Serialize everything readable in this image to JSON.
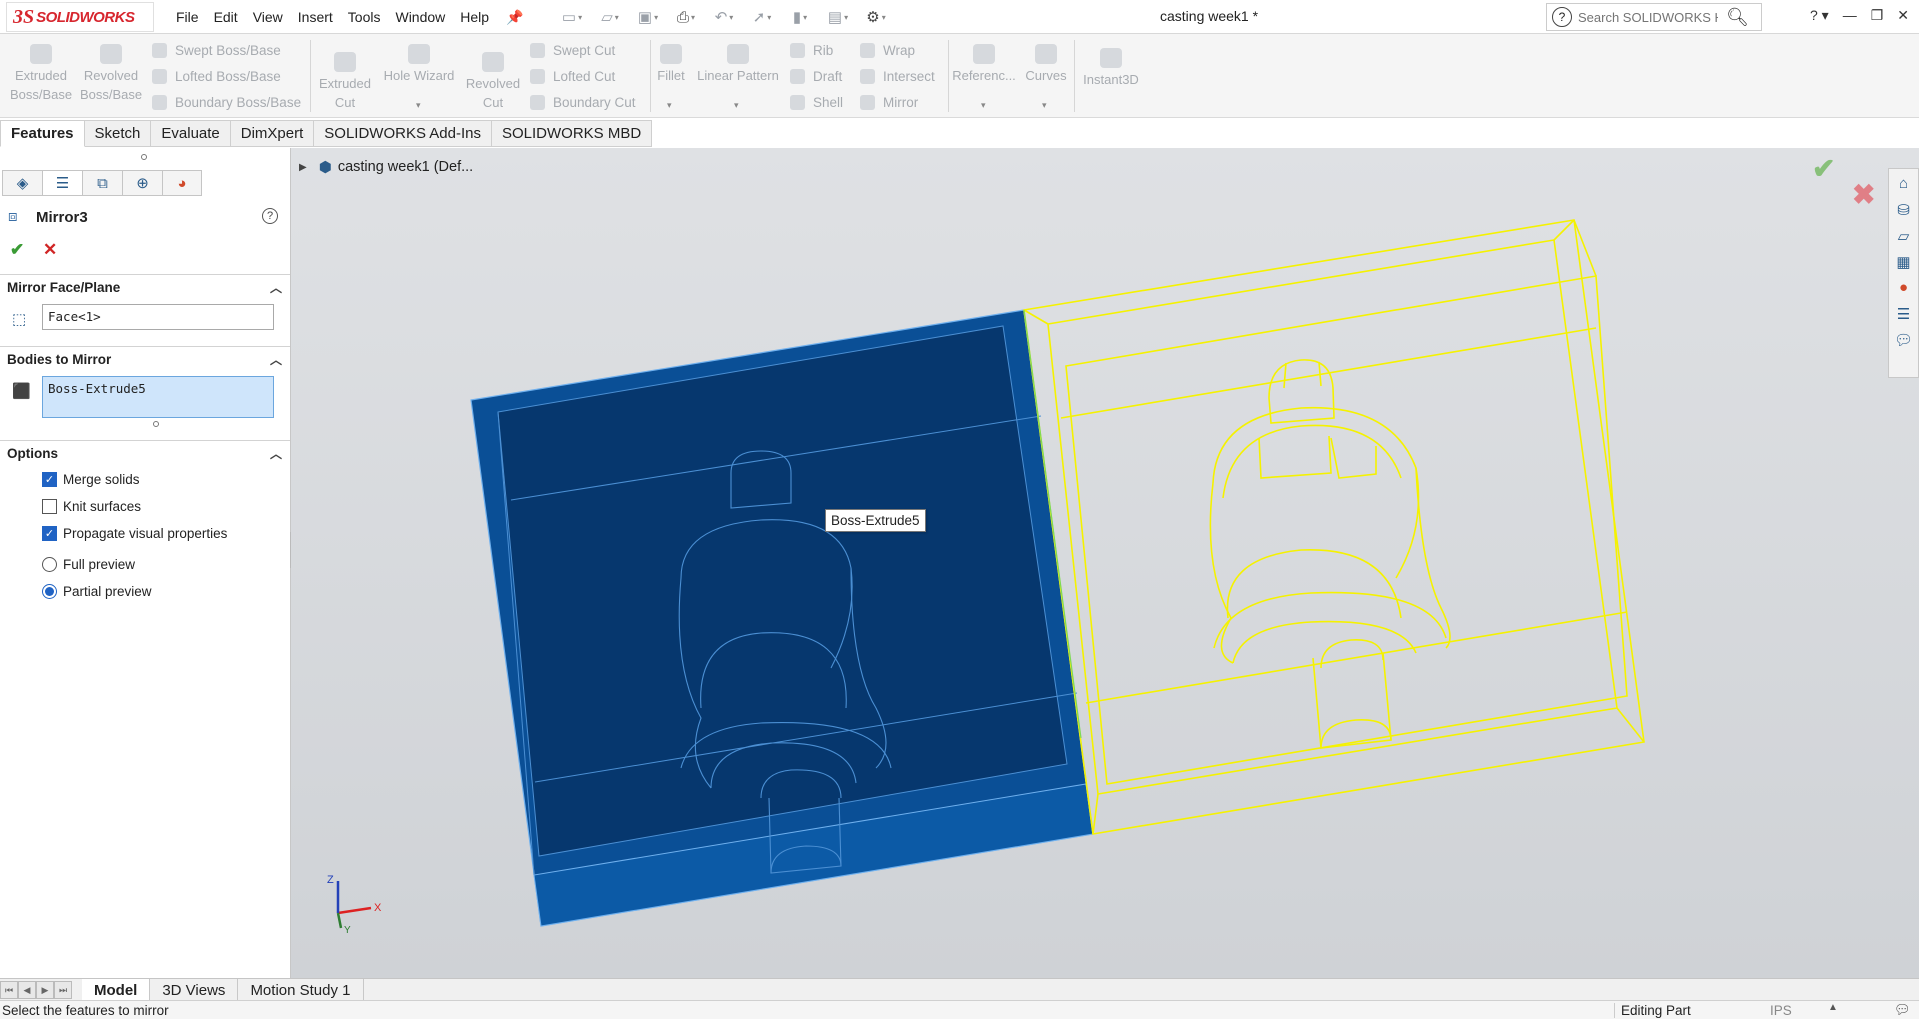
{
  "app": {
    "logo_mark": "3S",
    "logo_text": "SOLIDWORKS",
    "doc_title": "casting week1 *",
    "menu": [
      "File",
      "Edit",
      "View",
      "Insert",
      "Tools",
      "Window",
      "Help"
    ],
    "help_search_placeholder": "Search SOLIDWORKS Help",
    "accent_color": "#d7262e"
  },
  "ribbon": {
    "extruded_boss": [
      "Extruded",
      "Boss/Base"
    ],
    "revolved_boss": [
      "Revolved",
      "Boss/Base"
    ],
    "swept_boss": "Swept Boss/Base",
    "lofted_boss": "Lofted Boss/Base",
    "boundary_boss": "Boundary Boss/Base",
    "extruded_cut": [
      "Extruded",
      "Cut"
    ],
    "hole_wizard": "Hole Wizard",
    "revolved_cut": [
      "Revolved",
      "Cut"
    ],
    "swept_cut": "Swept Cut",
    "lofted_cut": "Lofted Cut",
    "boundary_cut": "Boundary Cut",
    "fillet": "Fillet",
    "linear_pattern": "Linear Pattern",
    "rib": "Rib",
    "draft": "Draft",
    "shell": "Shell",
    "wrap": "Wrap",
    "intersect": "Intersect",
    "mirror": "Mirror",
    "reference": "Referenc...",
    "curves": "Curves",
    "instant3d": "Instant3D"
  },
  "cm_tabs": [
    "Features",
    "Sketch",
    "Evaluate",
    "DimXpert",
    "SOLIDWORKS Add-Ins",
    "SOLIDWORKS MBD"
  ],
  "property_manager": {
    "title": "Mirror3",
    "help": "?",
    "mirror_face_label": "Mirror Face/Plane",
    "mirror_face_value": "Face<1>",
    "bodies_label": "Bodies to Mirror",
    "bodies_value": "Boss-Extrude5",
    "options_label": "Options",
    "options": {
      "merge_solids": {
        "label": "Merge solids",
        "checked": true
      },
      "knit_surfaces": {
        "label": "Knit surfaces",
        "checked": false
      },
      "propagate": {
        "label": "Propagate visual properties",
        "checked": true
      }
    },
    "full_preview": {
      "label": "Full preview",
      "selected": false
    },
    "partial_preview": {
      "label": "Partial preview",
      "selected": true
    }
  },
  "viewport": {
    "tree_label": "casting week1  (Def...",
    "tooltip": "Boss-Extrude5",
    "triad": {
      "z": "Z",
      "x": "X",
      "y": "Y"
    },
    "body_color": "#0a4f96",
    "preview_color": "#f5f200"
  },
  "bottom_tabs": [
    "Model",
    "3D Views",
    "Motion Study 1"
  ],
  "status": {
    "message": "Select the features to mirror",
    "mode": "Editing Part",
    "units": "IPS"
  }
}
